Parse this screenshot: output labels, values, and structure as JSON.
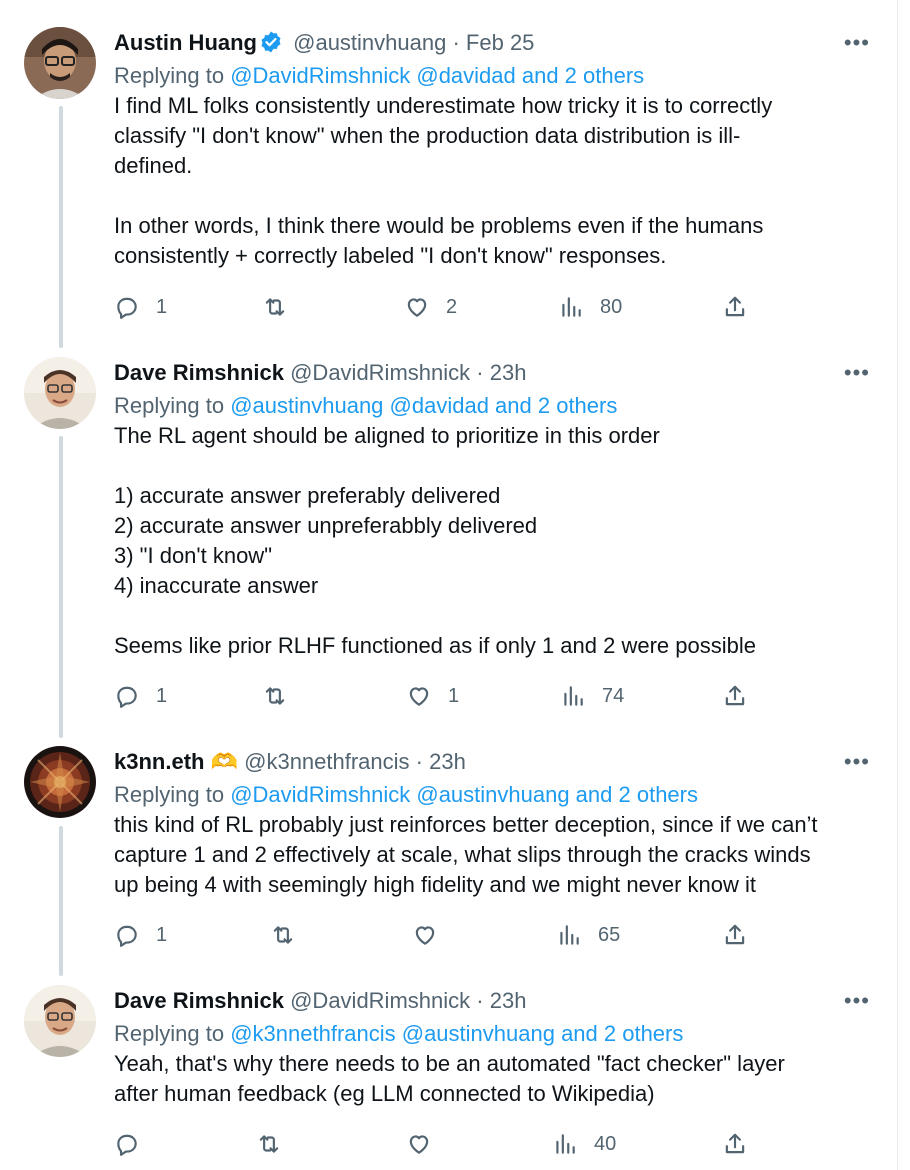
{
  "tweets": [
    {
      "name": "Austin Huang",
      "verified": true,
      "handle": "@austinvhuang",
      "time": "Feb 25",
      "replying_label": "Replying to",
      "replying_to": "@DavidRimshnick @davidad and 2 others",
      "text": "I find ML folks consistently underestimate how tricky it is to correctly\nclassify \"I don't know\" when the production data distribution is ill-\ndefined.\n\nIn other words, I think there would be problems even if the humans\nconsistently + correctly labeled \"I don't know\" responses.",
      "replies": "1",
      "retweets": "",
      "likes": "2",
      "views": "80"
    },
    {
      "name": "Dave Rimshnick",
      "verified": false,
      "handle": "@DavidRimshnick",
      "time": "23h",
      "replying_label": "Replying to",
      "replying_to": "@austinvhuang @davidad and 2 others",
      "text": "The RL agent should be aligned to prioritize in this order\n\n1) accurate answer preferably delivered\n2) accurate answer unpreferabbly delivered\n3) \"I don't know\"\n4) inaccurate answer\n\nSeems like prior RLHF functioned as if only 1 and 2 were possible",
      "replies": "1",
      "retweets": "",
      "likes": "1",
      "views": "74"
    },
    {
      "name": "k3nn.eth",
      "name_emoji": "🫶",
      "verified": false,
      "handle": "@k3nnethfrancis",
      "time": "23h",
      "replying_label": "Replying to",
      "replying_to": "@DavidRimshnick @austinvhuang and 2 others",
      "text": "this kind of RL probably just reinforces better deception, since if we can’t\ncapture 1 and 2 effectively at scale, what slips through the cracks winds\nup being 4 with seemingly high fidelity and we might never know it",
      "replies": "1",
      "retweets": "",
      "likes": "",
      "views": "65"
    },
    {
      "name": "Dave Rimshnick",
      "verified": false,
      "handle": "@DavidRimshnick",
      "time": "23h",
      "replying_label": "Replying to",
      "replying_to": "@k3nnethfrancis @austinvhuang and 2 others",
      "text": "Yeah, that's why there needs to be an automated \"fact checker\" layer\nafter human feedback (eg LLM connected to Wikipedia)",
      "replies": "",
      "retweets": "",
      "likes": "",
      "views": "40"
    }
  ],
  "separator": "·",
  "more_label": "•••",
  "colors": {
    "link": "#1d9bf0",
    "secondary": "#536471",
    "text": "#0f1419",
    "thread_line": "#cfd9de"
  },
  "icons": [
    "verified-badge-icon",
    "more-icon",
    "reply-icon",
    "retweet-icon",
    "like-icon",
    "views-icon",
    "share-icon"
  ]
}
